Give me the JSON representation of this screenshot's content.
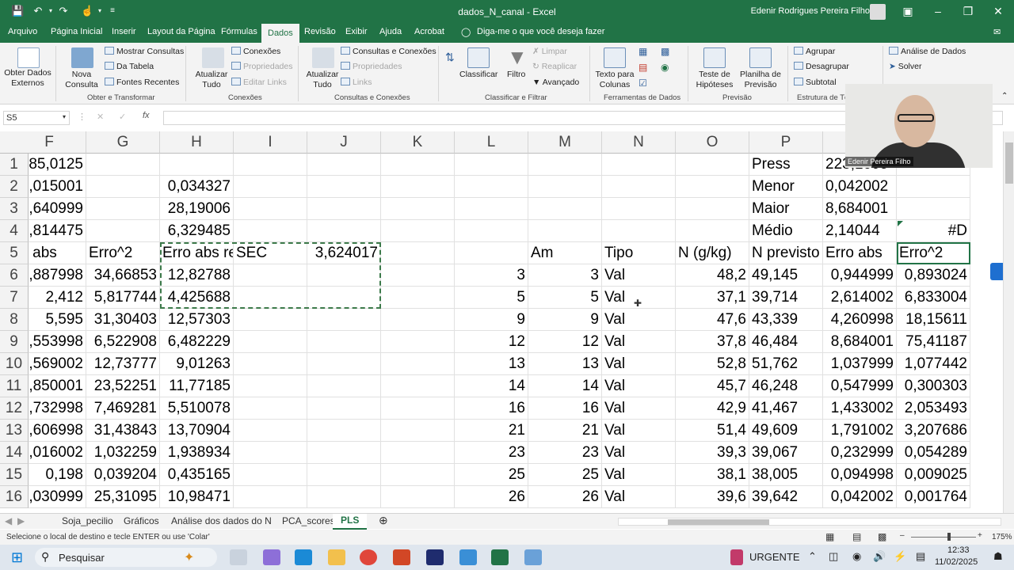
{
  "window": {
    "title": "dados_N_canal  -  Excel",
    "user": "Edenir Rodrigues Pereira Filho"
  },
  "menu": {
    "tabs": [
      "Arquivo",
      "Página Inicial",
      "Inserir",
      "Layout da Página",
      "Fórmulas",
      "Dados",
      "Revisão",
      "Exibir",
      "Ajuda",
      "Acrobat"
    ],
    "active": "Dados",
    "tell_me": "Diga-me o que você deseja fazer"
  },
  "ribbon": {
    "obter_dados": "Obter Dados\nExternos",
    "nova_consulta": "Nova\nConsulta",
    "mostrar_consultas": "Mostrar Consultas",
    "da_tabela": "Da Tabela",
    "fontes_recentes": "Fontes Recentes",
    "grp_obter": "Obter e Transformar",
    "atualizar_tudo_1": "Atualizar\nTudo",
    "conexoes": "Conexões",
    "propriedades": "Propriedades",
    "editar_links": "Editar Links",
    "grp_conexoes": "Conexões",
    "atualizar_tudo_2": "Atualizar\nTudo",
    "consultas_conexoes": "Consultas e Conexões",
    "propriedades_2": "Propriedades",
    "links": "Links",
    "grp_consultas": "Consultas e Conexões",
    "classificar": "Classificar",
    "filtro": "Filtro",
    "limpar": "Limpar",
    "reaplicar": "Reaplicar",
    "avancado": "Avançado",
    "grp_classificar": "Classificar e Filtrar",
    "texto_colunas": "Texto para\nColunas",
    "grp_ferramentas": "Ferramentas de Dados",
    "teste_hipoteses": "Teste de\nHipóteses",
    "planilha_previsao": "Planilha de\nPrevisão",
    "grp_previsao": "Previsão",
    "agrupar": "Agrupar",
    "desagrupar": "Desagrupar",
    "subtotal": "Subtotal",
    "grp_estrutura": "Estrutura de Tóp",
    "analise_dados": "Análise de Dados",
    "solver": "Solver"
  },
  "formula_bar": {
    "name_box": "S5",
    "formula": ""
  },
  "columns": [
    "F",
    "G",
    "H",
    "I",
    "J",
    "K",
    "L",
    "M",
    "N",
    "O",
    "P",
    "Q",
    "R"
  ],
  "rows": [
    {
      "n": "1",
      "F": "85,0125",
      "G": "",
      "H": "",
      "I": "",
      "J": "",
      "K": "",
      "L": "",
      "M": "",
      "N": "",
      "O": "",
      "P": "Press",
      "Q": "223,1605",
      "R": ""
    },
    {
      "n": "2",
      "F": ",015001",
      "G": "",
      "H": "0,034327",
      "I": "",
      "J": "",
      "K": "",
      "L": "",
      "M": "",
      "N": "",
      "O": "",
      "P": "Menor",
      "Q": "0,042002",
      "R": ""
    },
    {
      "n": "3",
      "F": ",640999",
      "G": "",
      "H": "28,19006",
      "I": "",
      "J": "",
      "K": "",
      "L": "",
      "M": "",
      "N": "",
      "O": "",
      "P": "Maior",
      "Q": "8,684001",
      "R": ""
    },
    {
      "n": "4",
      "F": ",814475",
      "G": "",
      "H": "6,329485",
      "I": "",
      "J": "",
      "K": "",
      "L": "",
      "M": "",
      "N": "",
      "O": "",
      "P": "Médio",
      "Q": "2,14044",
      "R": "#D"
    },
    {
      "n": "5",
      "F": "ro abs",
      "G": "Erro^2",
      "H": "Erro abs re",
      "I": "SEC",
      "J": "3,624017",
      "K": "",
      "L": "",
      "M": "Am",
      "N": "Tipo",
      "O": "N (g/kg)",
      "P": "N previsto",
      "Q": "Erro abs",
      "R": "Erro^2"
    },
    {
      "n": "6",
      "F": ",887998",
      "G": "34,66853",
      "H": "12,82788",
      "I": "",
      "J": "",
      "K": "",
      "L": "3",
      "M": "3",
      "N": "Val",
      "O": "48,2",
      "P": "49,145",
      "Q": "0,944999",
      "R": "0,893024"
    },
    {
      "n": "7",
      "F": "2,412",
      "G": "5,817744",
      "H": "4,425688",
      "I": "",
      "J": "",
      "K": "",
      "L": "5",
      "M": "5",
      "N": "Val",
      "O": "37,1",
      "P": "39,714",
      "Q": "2,614002",
      "R": "6,833004"
    },
    {
      "n": "8",
      "F": "5,595",
      "G": "31,30403",
      "H": "12,57303",
      "I": "",
      "J": "",
      "K": "",
      "L": "9",
      "M": "9",
      "N": "Val",
      "O": "47,6",
      "P": "43,339",
      "Q": "4,260998",
      "R": "18,15611"
    },
    {
      "n": "9",
      "F": ",553998",
      "G": "6,522908",
      "H": "6,482229",
      "I": "",
      "J": "",
      "K": "",
      "L": "12",
      "M": "12",
      "N": "Val",
      "O": "37,8",
      "P": "46,484",
      "Q": "8,684001",
      "R": "75,41187"
    },
    {
      "n": "10",
      "F": ",569002",
      "G": "12,73777",
      "H": "9,01263",
      "I": "",
      "J": "",
      "K": "",
      "L": "13",
      "M": "13",
      "N": "Val",
      "O": "52,8",
      "P": "51,762",
      "Q": "1,037999",
      "R": "1,077442"
    },
    {
      "n": "11",
      "F": ",850001",
      "G": "23,52251",
      "H": "11,77185",
      "I": "",
      "J": "",
      "K": "",
      "L": "14",
      "M": "14",
      "N": "Val",
      "O": "45,7",
      "P": "46,248",
      "Q": "0,547999",
      "R": "0,300303"
    },
    {
      "n": "12",
      "F": ",732998",
      "G": "7,469281",
      "H": "5,510078",
      "I": "",
      "J": "",
      "K": "",
      "L": "16",
      "M": "16",
      "N": "Val",
      "O": "42,9",
      "P": "41,467",
      "Q": "1,433002",
      "R": "2,053493"
    },
    {
      "n": "13",
      "F": ",606998",
      "G": "31,43843",
      "H": "13,70904",
      "I": "",
      "J": "",
      "K": "",
      "L": "21",
      "M": "21",
      "N": "Val",
      "O": "51,4",
      "P": "49,609",
      "Q": "1,791002",
      "R": "3,207686"
    },
    {
      "n": "14",
      "F": ",016002",
      "G": "1,032259",
      "H": "1,938934",
      "I": "",
      "J": "",
      "K": "",
      "L": "23",
      "M": "23",
      "N": "Val",
      "O": "39,3",
      "P": "39,067",
      "Q": "0,232999",
      "R": "0,054289"
    },
    {
      "n": "15",
      "F": "0,198",
      "G": "0,039204",
      "H": "0,435165",
      "I": "",
      "J": "",
      "K": "",
      "L": "25",
      "M": "25",
      "N": "Val",
      "O": "38,1",
      "P": "38,005",
      "Q": "0,094998",
      "R": "0,009025"
    },
    {
      "n": "16",
      "F": ",030999",
      "G": "25,31095",
      "H": "10,98471",
      "I": "",
      "J": "",
      "K": "",
      "L": "26",
      "M": "26",
      "N": "Val",
      "O": "39,6",
      "P": "39,642",
      "Q": "0,042002",
      "R": "0,001764"
    }
  ],
  "sheets": [
    "Soja_pecilio",
    "Gráficos",
    "Análise dos dados do N",
    "PCA_scores",
    "PLS"
  ],
  "active_sheet": "PLS",
  "status": {
    "message": "Selecione o local de destino e tecle ENTER ou use 'Colar'",
    "zoom": "175%"
  },
  "webcam": {
    "name": "Edenir Pereira Filho"
  },
  "taskbar": {
    "search": "Pesquisar",
    "urgent": "URGENTE",
    "time": "12:33",
    "date": "11/02/2025"
  },
  "colors": {
    "excel_green": "#217346",
    "copy_border": "#3c7a4a"
  }
}
